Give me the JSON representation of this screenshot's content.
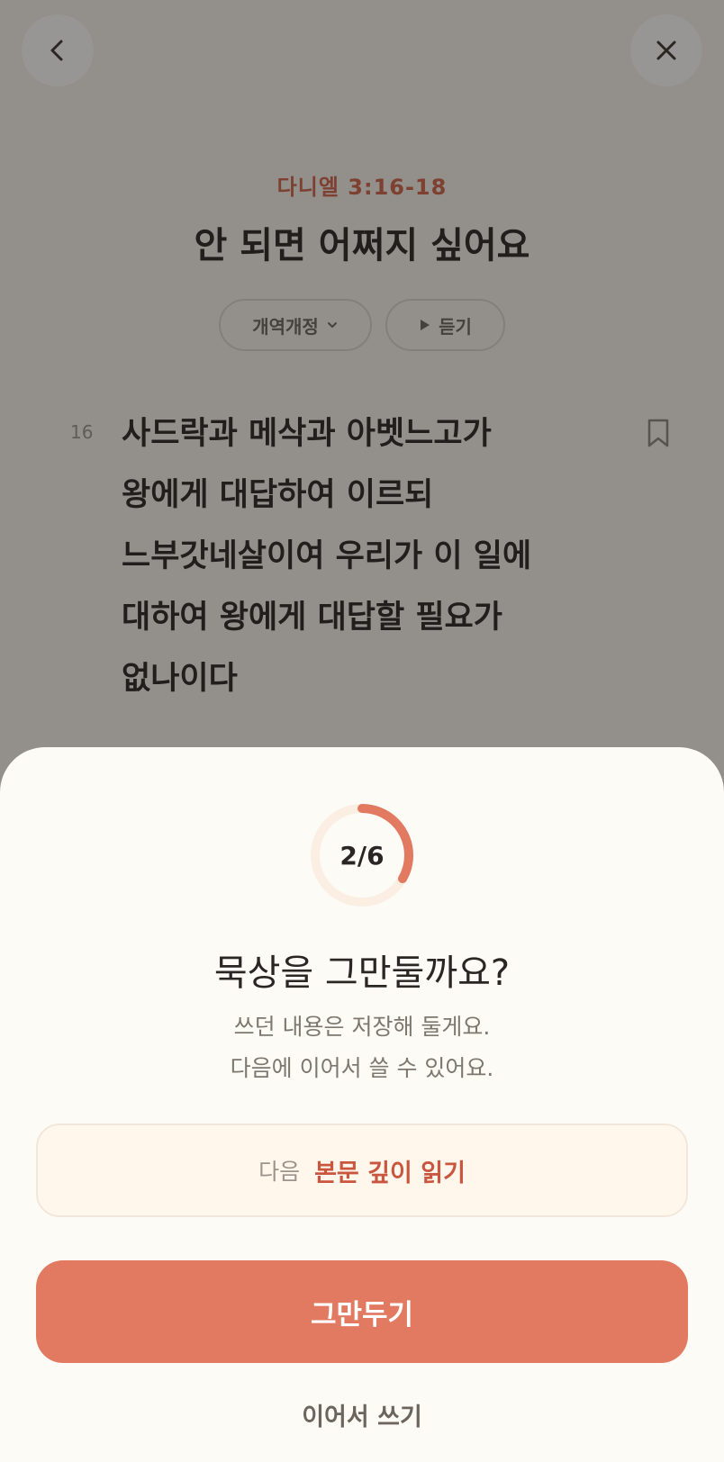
{
  "reader": {
    "reference": "다니엘 3:16-18",
    "title": "안 되면 어쩌지 싶어요",
    "version_label": "개역개정",
    "listen_label": "듣기",
    "verse": {
      "number": "16",
      "lines": [
        "사드락과 메삭과 아벳느고가",
        "왕에게 대답하여 이르되",
        "느부갓네살이여 우리가 이 일에",
        "대하여 왕에게 대답할 필요가",
        "없나이다"
      ]
    }
  },
  "sheet": {
    "progress": {
      "text": "2/6",
      "current": 2,
      "total": 6
    },
    "title": "묵상을 그만둘까요?",
    "desc_line1": "쓰던 내용은 저장해 둘게요.",
    "desc_line2": "다음에 이어서 쓸 수 있어요.",
    "next_label": "다음",
    "next_value": "본문 깊이 읽기",
    "quit_label": "그만두기",
    "continue_label": "이어서 쓰기"
  },
  "colors": {
    "accent": "#E27A61",
    "accent_text": "#C9573F",
    "reference": "#D0634A"
  },
  "icons": {
    "back": "chevron-left-icon",
    "close": "close-icon",
    "version": "chevron-down-icon",
    "listen": "play-icon",
    "bookmark": "bookmark-icon"
  }
}
